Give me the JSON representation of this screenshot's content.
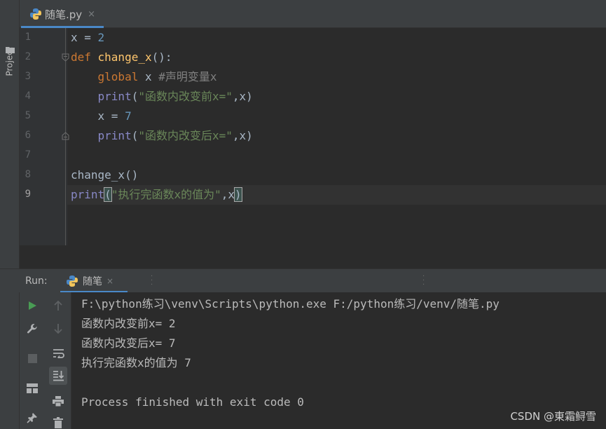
{
  "sidebar": {
    "project_label": "Project"
  },
  "tabs": [
    {
      "label": "随笔.py",
      "close": "×"
    }
  ],
  "editor": {
    "line_numbers": [
      "1",
      "2",
      "3",
      "4",
      "5",
      "6",
      "7",
      "8",
      "9"
    ],
    "current_line": 9,
    "lines": [
      [
        {
          "t": "x = ",
          "c": ""
        },
        {
          "t": "2",
          "c": "num"
        }
      ],
      [
        {
          "t": "def ",
          "c": "kw"
        },
        {
          "t": "change_x",
          "c": "fn"
        },
        {
          "t": "():",
          "c": ""
        }
      ],
      [
        {
          "t": "    ",
          "c": ""
        },
        {
          "t": "global ",
          "c": "kw"
        },
        {
          "t": "x ",
          "c": ""
        },
        {
          "t": "#声明变量x",
          "c": "cmt"
        }
      ],
      [
        {
          "t": "    ",
          "c": ""
        },
        {
          "t": "print",
          "c": "bi"
        },
        {
          "t": "(",
          "c": ""
        },
        {
          "t": "\"函数内改变前x=\"",
          "c": "str"
        },
        {
          "t": ",x)",
          "c": ""
        }
      ],
      [
        {
          "t": "    x = ",
          "c": ""
        },
        {
          "t": "7",
          "c": "num"
        }
      ],
      [
        {
          "t": "    ",
          "c": ""
        },
        {
          "t": "print",
          "c": "bi"
        },
        {
          "t": "(",
          "c": ""
        },
        {
          "t": "\"函数内改变后x=\"",
          "c": "str"
        },
        {
          "t": ",x)",
          "c": ""
        }
      ],
      [],
      [
        {
          "t": "change_x()",
          "c": ""
        }
      ],
      [
        {
          "t": "print",
          "c": "bi"
        },
        {
          "t": "(",
          "c": "brk"
        },
        {
          "t": "\"执行完函数x的值为\"",
          "c": "str"
        },
        {
          "t": ",x",
          "c": ""
        },
        {
          "t": ")",
          "c": "brk"
        }
      ]
    ]
  },
  "run_panel": {
    "title": "Run:",
    "tab_label": "随笔",
    "tab_close": "×",
    "output": [
      "F:\\python练习\\venv\\Scripts\\python.exe F:/python练习/venv/随笔.py",
      "函数内改变前x= 2",
      "函数内改变后x= 7",
      "执行完函数x的值为 7",
      "",
      "Process finished with exit code 0"
    ]
  },
  "watermark": "CSDN @東霜鲟雪",
  "colors": {
    "keyword": "#cc7832",
    "number": "#6897bb",
    "function": "#ffc66d",
    "builtin": "#8888c6",
    "string": "#6a8759",
    "comment": "#808080",
    "run_green": "#499c54",
    "accent": "#4a88c7"
  },
  "icons": [
    "python-file-icon",
    "folder-icon",
    "rerun-icon",
    "wrench-icon",
    "stop-icon",
    "layout-icon",
    "pin-icon",
    "up-arrow-icon",
    "down-arrow-icon",
    "soft-wrap-icon",
    "scroll-to-end-icon",
    "print-icon",
    "trash-icon"
  ]
}
